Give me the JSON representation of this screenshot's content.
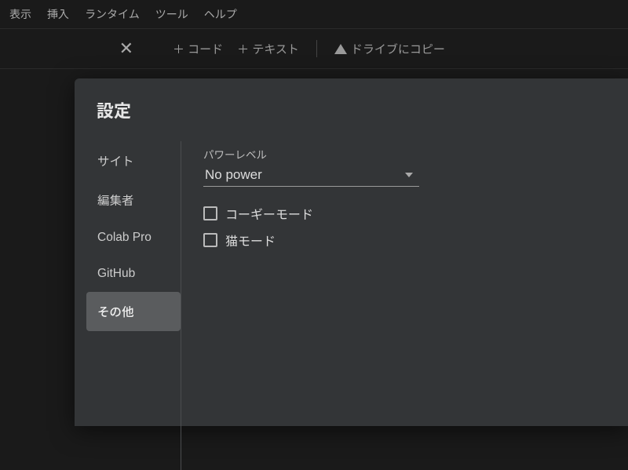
{
  "menubar": {
    "view": "表示",
    "insert": "挿入",
    "runtime": "ランタイム",
    "tools": "ツール",
    "help": "ヘルプ"
  },
  "toolbar": {
    "code": "＋ コード",
    "text": "＋ テキスト",
    "drive": "ドライブにコピー"
  },
  "settings": {
    "title": "設定",
    "nav": {
      "site": "サイト",
      "editor": "編集者",
      "colab_pro": "Colab Pro",
      "github": "GitHub",
      "other": "その他"
    },
    "power_level_label": "パワーレベル",
    "power_level_value": "No power",
    "corgi_mode": "コーギーモード",
    "cat_mode": "猫モード"
  }
}
